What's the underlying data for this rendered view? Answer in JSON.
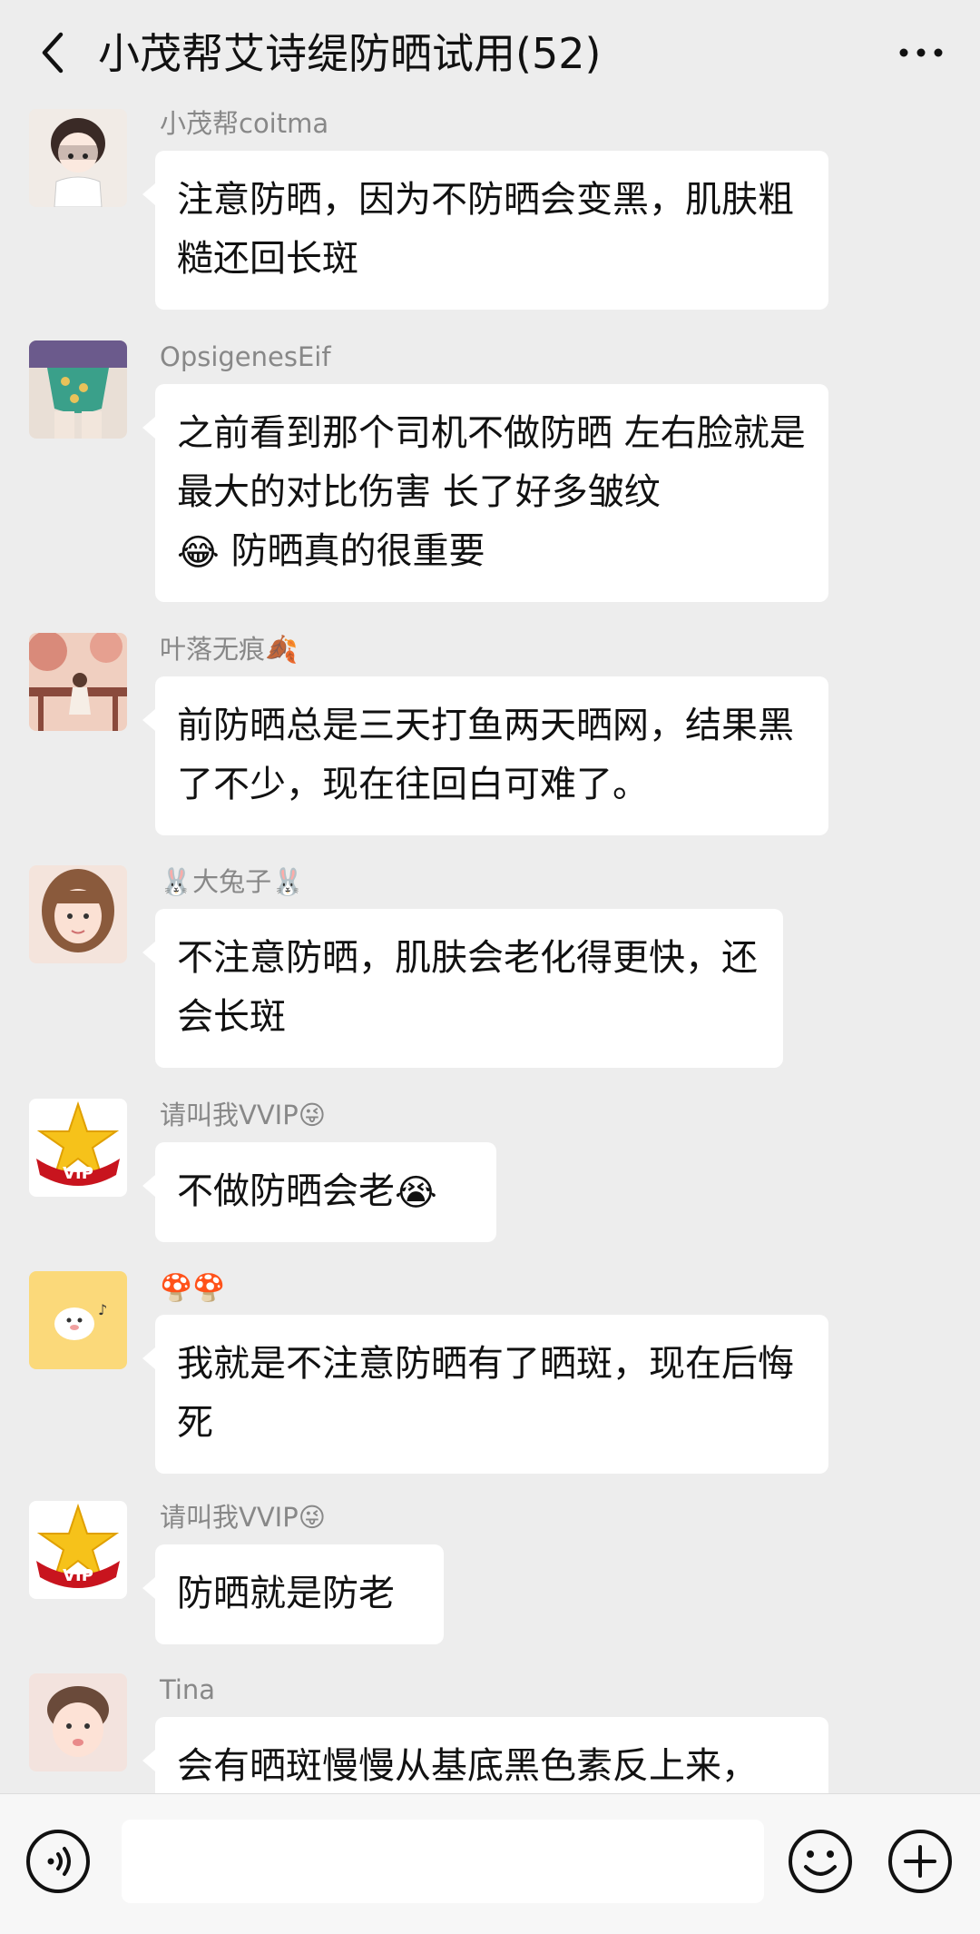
{
  "header": {
    "title": "小茂帮艾诗缇防晒试用(52)"
  },
  "messages": [
    {
      "sender": "小茂帮coitma",
      "text": "注意防晒，因为不防晒会变黑，肌肤粗糙还回长斑"
    },
    {
      "sender": "OpsigenesEif",
      "text": "之前看到那个司机不做防晒 左右脸就是最大的对比伤害 长了好多皱纹",
      "text2": "防晒真的很重要",
      "emoji": "😂"
    },
    {
      "sender": "叶落无痕",
      "sender_emoji": "🍂",
      "text": "前防晒总是三天打鱼两天晒网，结果黑了不少，现在往回白可难了。"
    },
    {
      "sender": "大兔子",
      "sender_emoji": "🐰",
      "text": "不注意防晒，肌肤会老化得更快，还会长斑"
    },
    {
      "sender": "请叫我VVIP",
      "sender_emoji": "😜",
      "text": "不做防晒会老",
      "emoji": "😭",
      "badge": "VIP"
    },
    {
      "sender": "",
      "sender_emoji": "🍄🍄",
      "text": "我就是不注意防晒有了晒斑，现在后悔死"
    },
    {
      "sender": "请叫我VVIP",
      "sender_emoji": "😜",
      "text": "防晒就是防老",
      "badge": "VIP"
    },
    {
      "sender": "Tina",
      "text": "会有晒斑慢慢从基底黑色素反上来，"
    }
  ],
  "input": {
    "placeholder": ""
  },
  "colors": {
    "background": "#ededed",
    "bubble": "#ffffff",
    "sender": "#888888"
  }
}
